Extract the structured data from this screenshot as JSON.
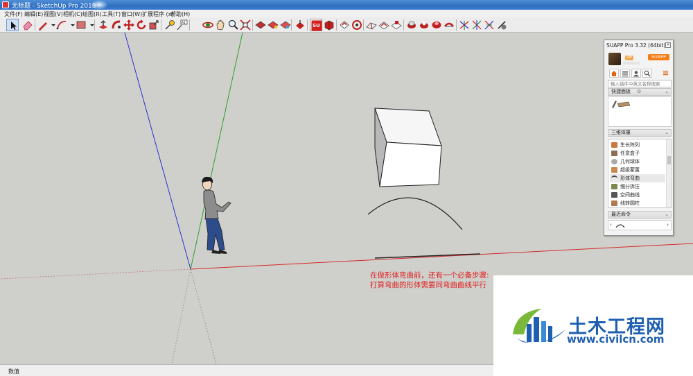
{
  "window": {
    "title": "无标题 - SketchUp Pro 2018"
  },
  "menu": [
    "文件(F)",
    "编辑(E)",
    "视图(V)",
    "相机(C)",
    "绘图(R)",
    "工具(T)",
    "窗口(W)",
    "扩展程序 (x)",
    "帮助(H)"
  ],
  "toolbar": {
    "su_badge": "SU",
    "icons": [
      "select-arrow-icon",
      "eraser-icon",
      "pencil-icon",
      "arc-icon",
      "rectangle-icon",
      "push-pull-icon",
      "follow-me-icon",
      "move-icon",
      "rotate-icon",
      "scale-icon",
      "tape-measure-icon",
      "dimension-icon",
      "orbit-icon",
      "pan-icon",
      "zoom-icon",
      "zoom-extents-icon",
      "suapp-icon",
      "component-icon"
    ]
  },
  "annotation": {
    "line1": "在做形体弯曲前，还有一个必备步骤:",
    "line2": "打算弯曲的形体需要同弯曲曲线平行"
  },
  "status": {
    "label": "数值"
  },
  "suapp_panel": {
    "title": "SUAPP Pro 3.32 (64bit)",
    "close": "×",
    "vip": "VIP",
    "version_badge": "SUAPP 3.32",
    "search_placeholder": "输入插件中英文名称搜索",
    "quick_panel_label": "快捷面板",
    "category_label": "三维体量",
    "plugins": [
      "生长阵列",
      "任意盒子",
      "几何球体",
      "超级蒙置",
      "形体弯曲",
      "细分拆压",
      "空间曲线",
      "线转圆柱"
    ],
    "recent_label": "最近命令"
  },
  "watermark": {
    "brand": "土木工程网",
    "url": "www.civilcn.com"
  },
  "colors": {
    "axis_red": "#d42a2a",
    "axis_green": "#2aa02a",
    "axis_blue": "#2f2fcf",
    "annotation": "#e02020",
    "brand_blue": "#1f5fb0",
    "suapp_orange": "#f57d14"
  }
}
